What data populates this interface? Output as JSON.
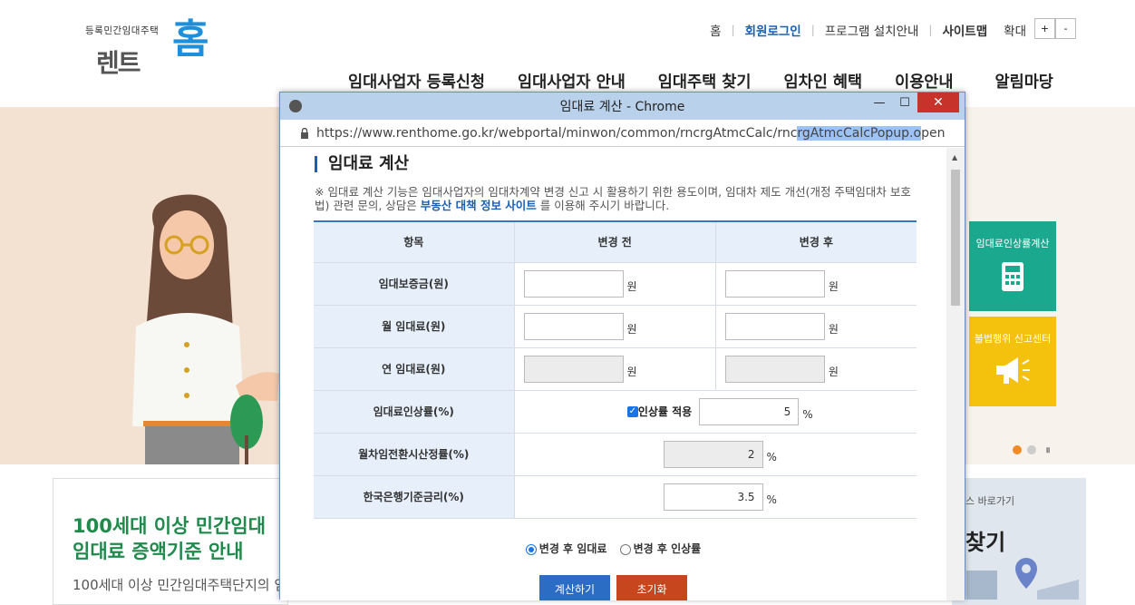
{
  "site": {
    "logo_small": "등록민간임대주택",
    "logo_rent": "렌트",
    "logo_home": "홈",
    "topnav": [
      "홈",
      "회원로그인",
      "프로그램 설치안내",
      "사이트맵",
      "확대"
    ],
    "zoom_plus": "+",
    "zoom_minus": "-",
    "mainnav": [
      "임대사업자 등록신청",
      "임대사업자 안내",
      "임대주택 찾기",
      "임차인 혜택",
      "이용안내",
      "알림마당"
    ]
  },
  "hero": {
    "card_green": "임대료인상률계산",
    "card_yellow": "불법행위 신고센터",
    "pause": "॥"
  },
  "notice": {
    "title": "100세대 이상 민간임대\n임대료 증액기준 안내",
    "sub": "100세대 이상 민간임대주택단지의 임"
  },
  "find": {
    "small": "스 바로가기",
    "big": "찾기"
  },
  "popup": {
    "title": "임대료 계산 - Chrome",
    "url_before": "https://www.renthome.go.kr/webportal/minwon/common/rncrgAtmcCalc/rnc",
    "url_highlight": "rgAtmcCalcPopup.o",
    "url_after": "pen",
    "section_title": "임대료 계산",
    "desc_pre": "※ 임대료 계산 기능은 임대사업자의 임대차계약 변경 신고 시 활용하기 위한 용도이며, 임대차 제도 개선(개정 주택임대차 보호법) 관련 문의, 상담은 ",
    "desc_link": "부동산 대책 정보 사이트",
    "desc_post": " 를 이용해 주시기 바랍니다.",
    "table": {
      "headers": [
        "항목",
        "변경 전",
        "변경 후"
      ],
      "rows": [
        {
          "label": "임대보증금(원)",
          "before": "",
          "after": ""
        },
        {
          "label": "월 임대료(원)",
          "before": "",
          "after": ""
        },
        {
          "label": "연 임대료(원)",
          "before": "",
          "after": ""
        }
      ],
      "unit_won": "원",
      "rate_label": "임대료인상률(%)",
      "rate_checkbox_label": "인상률 적용",
      "rate_value": "5",
      "conv_label": "월차임전환시산정률(%)",
      "conv_value": "2",
      "bank_label": "한국은행기준금리(%)",
      "bank_value": "3.5",
      "unit_pct": "%"
    },
    "radio_after_rent": "변경 후 임대료",
    "radio_after_rate": "변경 후 인상률",
    "btn_calc": "계산하기",
    "btn_reset": "초기화"
  },
  "colors": {
    "brand_blue": "#1e8fd8",
    "green_card": "#1aa98e",
    "yellow_card": "#f4c20d",
    "calc_button": "#2b6cc4",
    "reset_button": "#c8461d"
  }
}
